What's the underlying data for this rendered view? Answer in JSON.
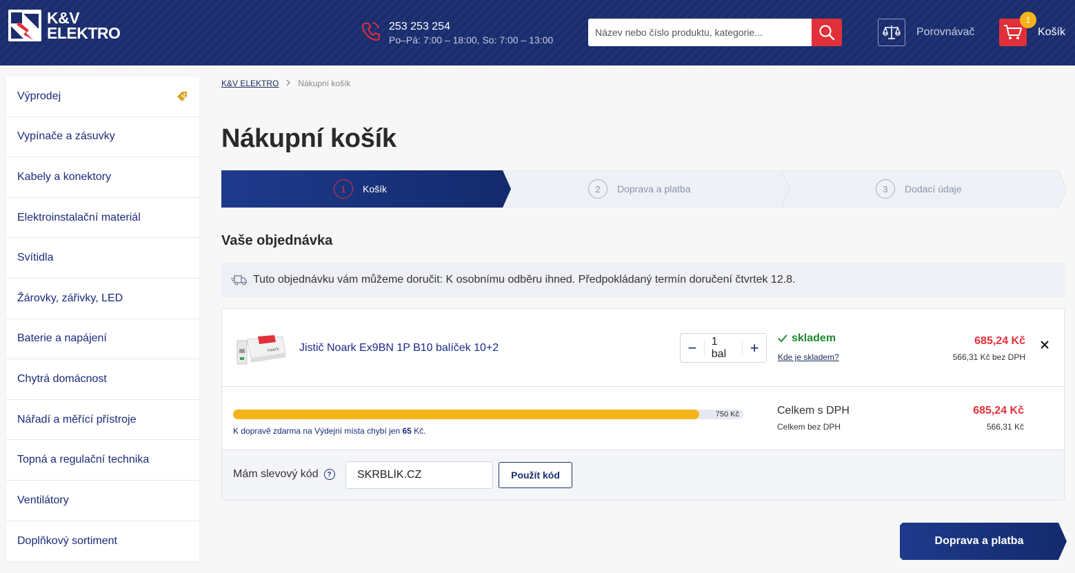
{
  "header": {
    "logo_line1": "K&V",
    "logo_line2": "ELEKTRO",
    "phone": "253 253 254",
    "hours": "Po–Pá: 7:00 – 18:00, So: 7:00 – 13:00",
    "search_placeholder": "Název nebo číslo produktu, kategorie...",
    "compare_label": "Porovnávač",
    "cart_label": "Košík",
    "cart_count": "1"
  },
  "sidebar": {
    "items": [
      {
        "label": "Výprodej",
        "icon": "sale-tag-icon"
      },
      {
        "label": "Vypínače a zásuvky"
      },
      {
        "label": "Kabely a konektory"
      },
      {
        "label": "Elektroinstalační materiál"
      },
      {
        "label": "Svítidla"
      },
      {
        "label": "Žárovky, zářivky, LED"
      },
      {
        "label": "Baterie a napájení"
      },
      {
        "label": "Chytrá domácnost"
      },
      {
        "label": "Nářadí a měřící přístroje"
      },
      {
        "label": "Topná a regulační technika"
      },
      {
        "label": "Ventilátory"
      },
      {
        "label": "Doplňkový sortiment"
      }
    ]
  },
  "breadcrumb": {
    "home": "K&V ELEKTRO",
    "current": "Nákupní košík"
  },
  "page": {
    "title": "Nákupní košík",
    "order_title": "Vaše objednávka",
    "notice": "Tuto objednávku vám můžeme doručit: K osobnímu odběru ihned. Předpokládaný termín doručení čtvrtek 12.8."
  },
  "steps": [
    {
      "num": "1",
      "label": "Košík",
      "active": true
    },
    {
      "num": "2",
      "label": "Doprava a platba",
      "active": false
    },
    {
      "num": "3",
      "label": "Dodací údaje",
      "active": false
    }
  ],
  "item": {
    "name": "Jistič Noark Ex9BN 1P B10 balíček 10+2",
    "quantity": "1 bal",
    "minus": "−",
    "plus": "+",
    "stock": "skladem",
    "stock_link": "Kde je skladem?",
    "price": "685,24 Kč",
    "price_net": "566,31 Kč bez DPH"
  },
  "shipping": {
    "progress_fraction": 0.913,
    "threshold_label": "750 Kč",
    "text_before": "K dopravě zdarma na Výdejní místa chybí jen ",
    "missing": "65",
    "text_after": " Kč."
  },
  "totals": {
    "with_vat_label": "Celkem s DPH",
    "with_vat": "685,24 Kč",
    "without_vat_label": "Celkem bez DPH",
    "without_vat": "566,31 Kč"
  },
  "coupon": {
    "label": "Mám slevový kód",
    "help": "?",
    "value": "SKRBLÍK.CZ",
    "button": "Použít kód"
  },
  "next_button": "Doprava a platba",
  "colors": {
    "brand_navy": "#1a2d6e",
    "accent_red": "#e1303a",
    "progress_yellow": "#f4b41a",
    "stock_green": "#1c8a2c"
  }
}
